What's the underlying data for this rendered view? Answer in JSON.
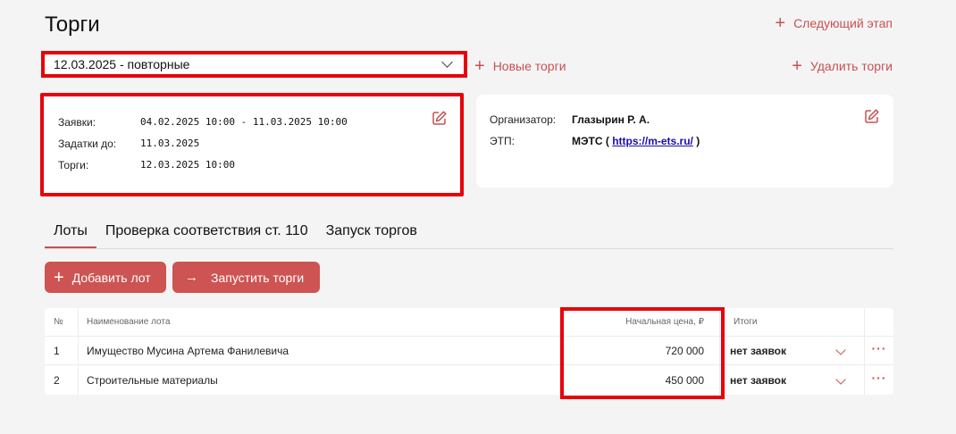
{
  "page": {
    "title": "Торги"
  },
  "actions": {
    "next_stage": "Следующий этап",
    "new_auction": "Новые торги",
    "delete_auction": "Удалить торги"
  },
  "auction_select": {
    "value": "12.03.2025 - повторные"
  },
  "dates_card": {
    "applications_label": "Заявки:",
    "applications_value": "04.02.2025 10:00 - 11.03.2025 10:00",
    "deposits_label": "Задатки до:",
    "deposits_value": "11.03.2025",
    "auction_label": "Торги:",
    "auction_value": "12.03.2025 10:00"
  },
  "org_card": {
    "organizer_label": "Организатор:",
    "organizer_value": "Глазырин Р. А.",
    "etp_label": "ЭТП:",
    "etp_name": "МЭТС (",
    "etp_link": "https://m-ets.ru/",
    "etp_close": ")"
  },
  "tabs": [
    {
      "label": "Лоты"
    },
    {
      "label": "Проверка соответствия ст. 110"
    },
    {
      "label": "Запуск торгов"
    }
  ],
  "buttons": {
    "add_lot": "Добавить лот",
    "run_auction": "Запустить торги"
  },
  "table": {
    "headers": {
      "num": "№",
      "name": "Наименование лота",
      "price": "Начальная цена, ₽",
      "result": "Итоги"
    },
    "rows": [
      {
        "num": "1",
        "name": "Имущество Мусина Артема Фанилевича",
        "price": "720 000",
        "result": "нет заявок"
      },
      {
        "num": "2",
        "name": "Строительные материалы",
        "price": "450 000",
        "result": "нет заявок"
      }
    ]
  },
  "colors": {
    "accent": "#c9504f",
    "highlight": "#e8020a",
    "link": "#1a0dab"
  },
  "icons": {
    "edit": "edit-icon",
    "plus": "plus-icon",
    "arrow": "arrow-right-icon",
    "chevron": "chevron-down-icon",
    "more": "more-icon"
  }
}
